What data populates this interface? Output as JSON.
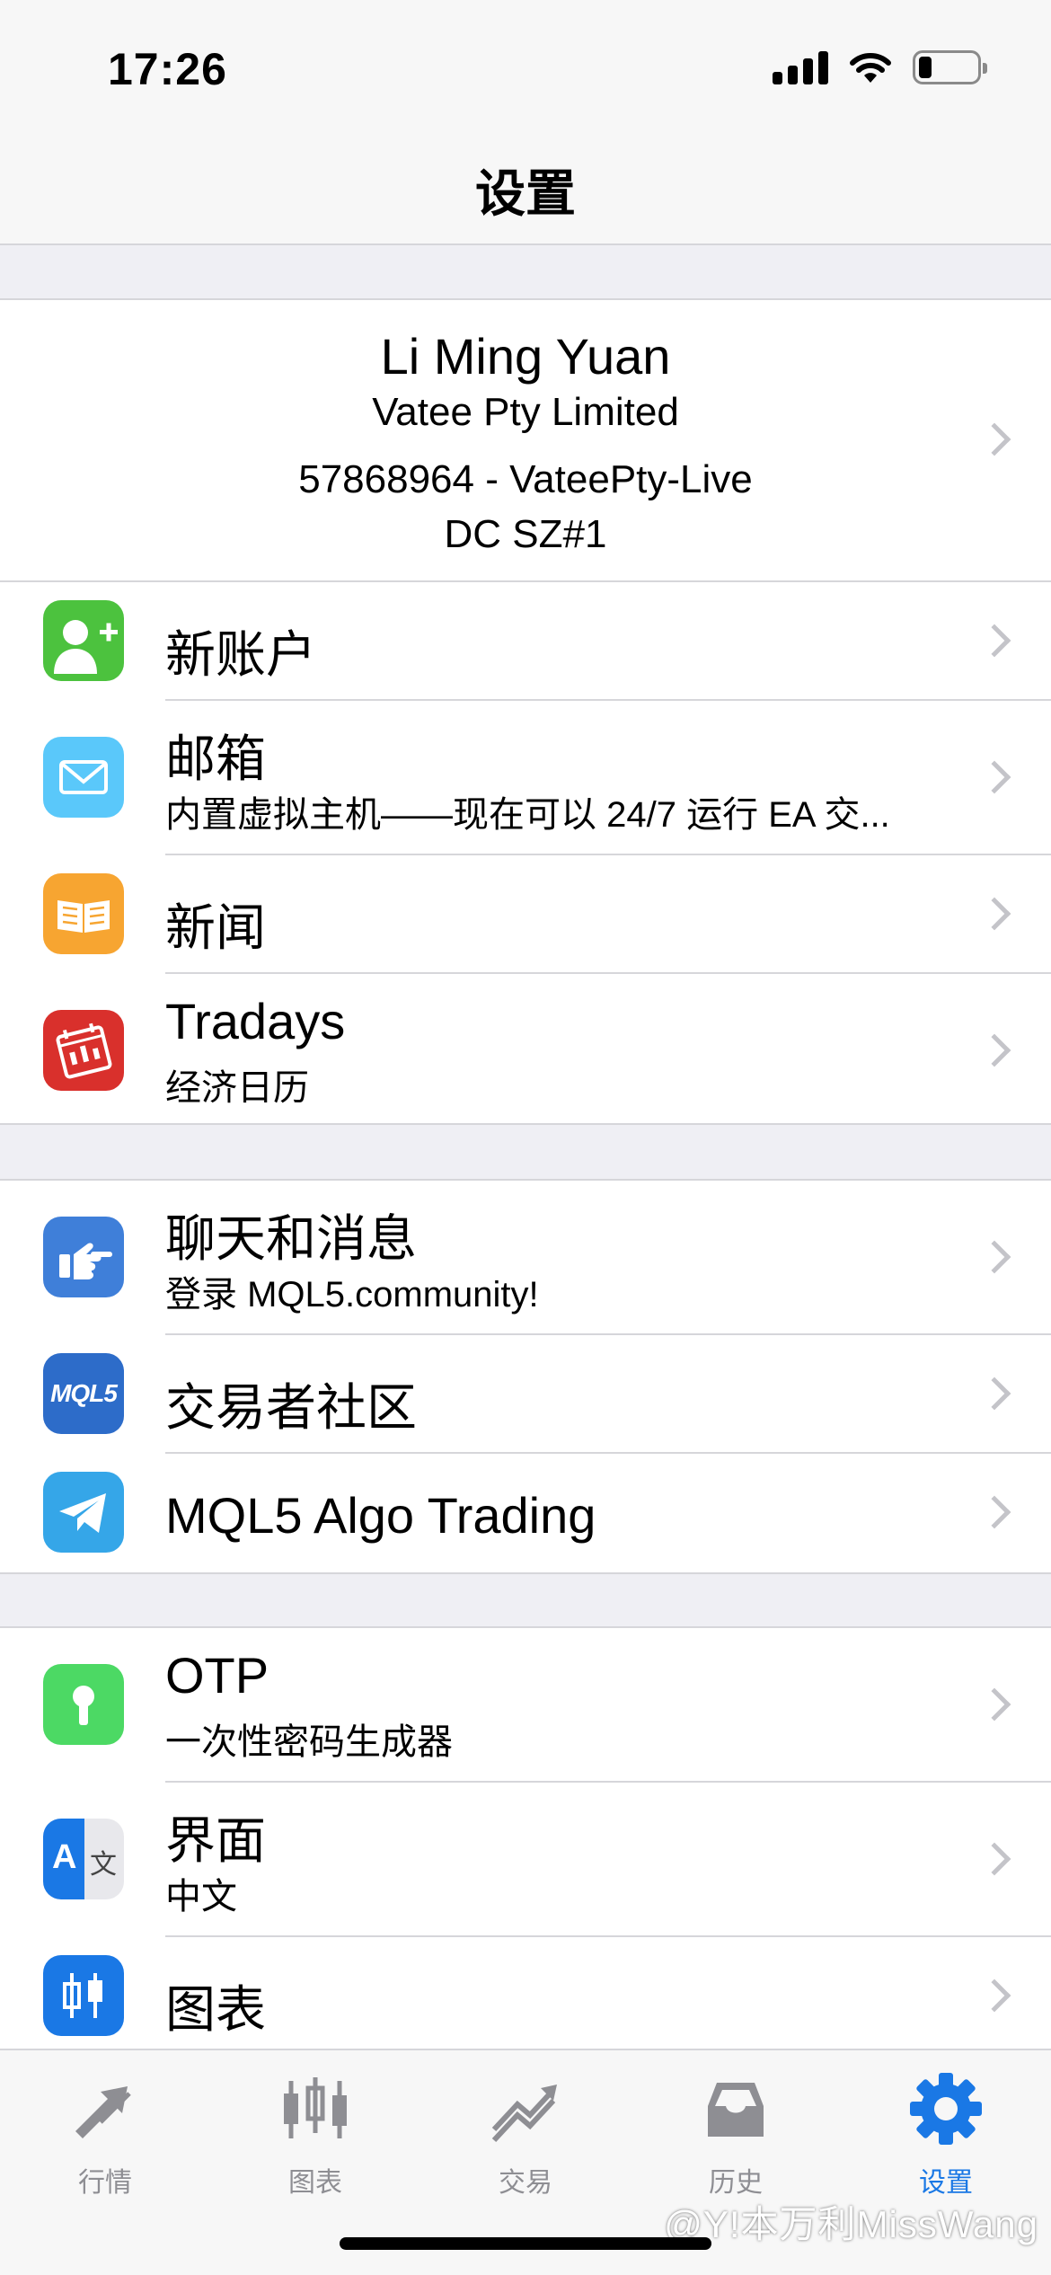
{
  "status_bar": {
    "time": "17:26"
  },
  "header": {
    "title": "设置"
  },
  "account": {
    "name": "Li Ming Yuan",
    "company": "Vatee Pty Limited",
    "number": "57868964 - VateePty-Live",
    "server": "DC SZ#1"
  },
  "section1": [
    {
      "title": "新账户",
      "icon": "add-user-icon",
      "color": "#4cc23e"
    },
    {
      "title": "邮箱",
      "subtitle": "内置虚拟主机——现在可以 24/7 运行 EA 交...",
      "icon": "mail-icon",
      "color": "#5ac8fa"
    },
    {
      "title": "新闻",
      "icon": "book-icon",
      "color": "#f7a531"
    },
    {
      "title": "Tradays",
      "subtitle": "经济日历",
      "icon": "calendar-icon",
      "color": "#d9302c"
    }
  ],
  "section2": [
    {
      "title": "聊天和消息",
      "subtitle": "登录 MQL5.community!",
      "icon": "chat-hand-icon",
      "color": "#3f7fd9"
    },
    {
      "title": "交易者社区",
      "icon": "mql5-logo-icon",
      "icon_text": "MQL5",
      "color": "#2d6cc9"
    },
    {
      "title": "MQL5 Algo Trading",
      "icon": "telegram-icon",
      "color": "#35a6e8"
    }
  ],
  "section3": [
    {
      "title": "OTP",
      "subtitle": "一次性密码生成器",
      "icon": "key-icon",
      "color": "#4cd964"
    },
    {
      "title": "界面",
      "subtitle": "中文",
      "icon": "translate-icon",
      "icon_text_a": "A",
      "icon_text_b": "文",
      "color": "#1a78e5"
    },
    {
      "title": "图表",
      "icon": "candles-icon",
      "color": "#1a78e5"
    }
  ],
  "tabs": [
    {
      "label": "行情",
      "icon": "quotes-icon"
    },
    {
      "label": "图表",
      "icon": "chart-icon"
    },
    {
      "label": "交易",
      "icon": "trade-icon"
    },
    {
      "label": "历史",
      "icon": "history-icon"
    },
    {
      "label": "设置",
      "icon": "settings-icon",
      "active": true
    }
  ],
  "watermark": "@Y!本万利MissWang"
}
